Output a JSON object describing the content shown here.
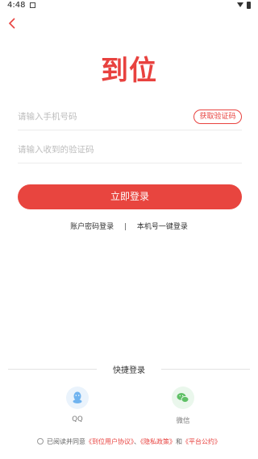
{
  "status_bar": {
    "time": "4:48"
  },
  "logo": {
    "text": "到位"
  },
  "form": {
    "phone_placeholder": "请输入手机号码",
    "code_placeholder": "请输入收到的验证码",
    "get_code_label": "获取验证码",
    "login_label": "立即登录"
  },
  "alt_login": {
    "password_login": "账户密码登录",
    "separator": "|",
    "one_click_login": "本机号一键登录"
  },
  "quick_login": {
    "title": "快捷登录",
    "options": [
      {
        "label": "QQ",
        "icon": "qq-icon"
      },
      {
        "label": "微信",
        "icon": "wechat-icon"
      }
    ]
  },
  "agreement": {
    "prefix": "已阅读并同意",
    "user_agreement": "《到位用户协议》",
    "sep1": "、",
    "privacy_policy": "《隐私政策》",
    "and": "和",
    "platform_convention": "《平台公约》"
  },
  "colors": {
    "brand": "#e8423f",
    "qq": "#6fb3ef",
    "wechat": "#5fc066"
  }
}
